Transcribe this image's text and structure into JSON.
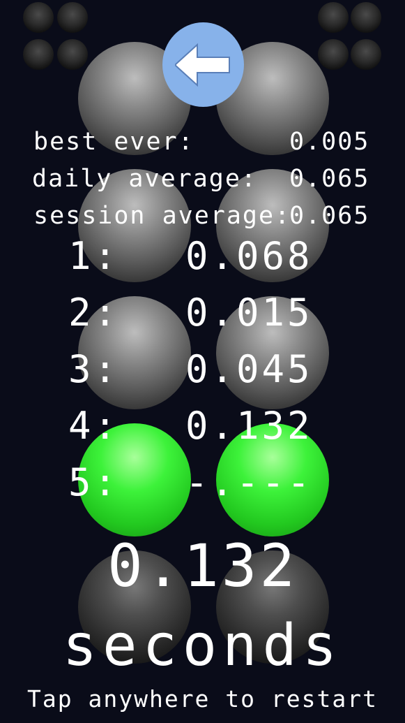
{
  "back_button": {
    "icon": "arrow-left-icon",
    "color": "#87b2ea"
  },
  "stats": {
    "best_ever": {
      "label": "best ever:",
      "value": "0.005"
    },
    "daily_average": {
      "label": "daily average:",
      "value": "0.065"
    },
    "session_average": {
      "label": "session average:",
      "value": "0.065"
    }
  },
  "trials": [
    {
      "label": "1:",
      "value": "0.068"
    },
    {
      "label": "2:",
      "value": "0.015"
    },
    {
      "label": "3:",
      "value": "0.045"
    },
    {
      "label": "4:",
      "value": "0.132"
    },
    {
      "label": "5:",
      "value": "-.---"
    }
  ],
  "result": {
    "time": "0.132",
    "unit": "seconds"
  },
  "restart_hint": "Tap anywhere to restart",
  "lights": {
    "row1": "off",
    "row2": "off",
    "row3": "off",
    "row4": "lit",
    "row5": "off",
    "lit_color": "#3df23a"
  }
}
